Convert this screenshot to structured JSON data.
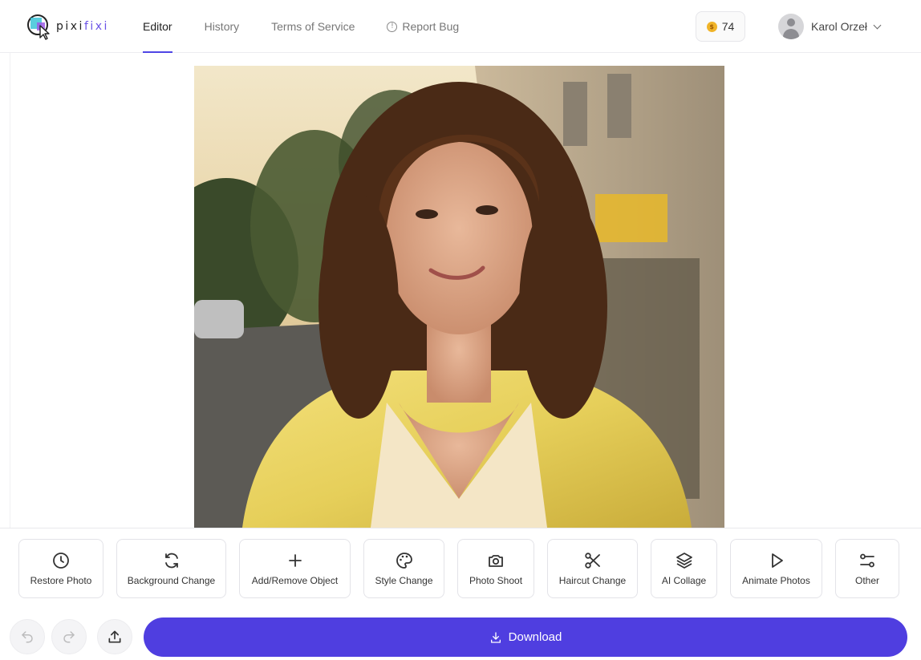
{
  "app": {
    "logo_text_a": "pixi",
    "logo_text_b": "fixi"
  },
  "nav": {
    "items": [
      {
        "label": "Editor",
        "active": true
      },
      {
        "label": "History"
      },
      {
        "label": "Terms of Service"
      },
      {
        "label": "Report Bug",
        "icon": "info-icon"
      }
    ]
  },
  "credits": {
    "count": "74",
    "icon": "coin-icon"
  },
  "user": {
    "name": "Karol Orzeł",
    "icon": "avatar-icon"
  },
  "tools": [
    {
      "label": "Restore Photo",
      "icon": "clock-icon"
    },
    {
      "label": "Background Change",
      "icon": "refresh-icon"
    },
    {
      "label": "Add/Remove Object",
      "icon": "plus-icon"
    },
    {
      "label": "Style Change",
      "icon": "palette-icon"
    },
    {
      "label": "Photo Shoot",
      "icon": "camera-icon"
    },
    {
      "label": "Haircut Change",
      "icon": "scissors-icon"
    },
    {
      "label": "AI Collage",
      "icon": "layers-icon"
    },
    {
      "label": "Animate Photos",
      "icon": "play-icon"
    },
    {
      "label": "Other",
      "icon": "sliders-icon"
    }
  ],
  "actions": {
    "download_label": "Download"
  },
  "colors": {
    "accent": "#4f3ee0",
    "brand_purple": "#6a52e6",
    "coin": "#f0b429"
  }
}
